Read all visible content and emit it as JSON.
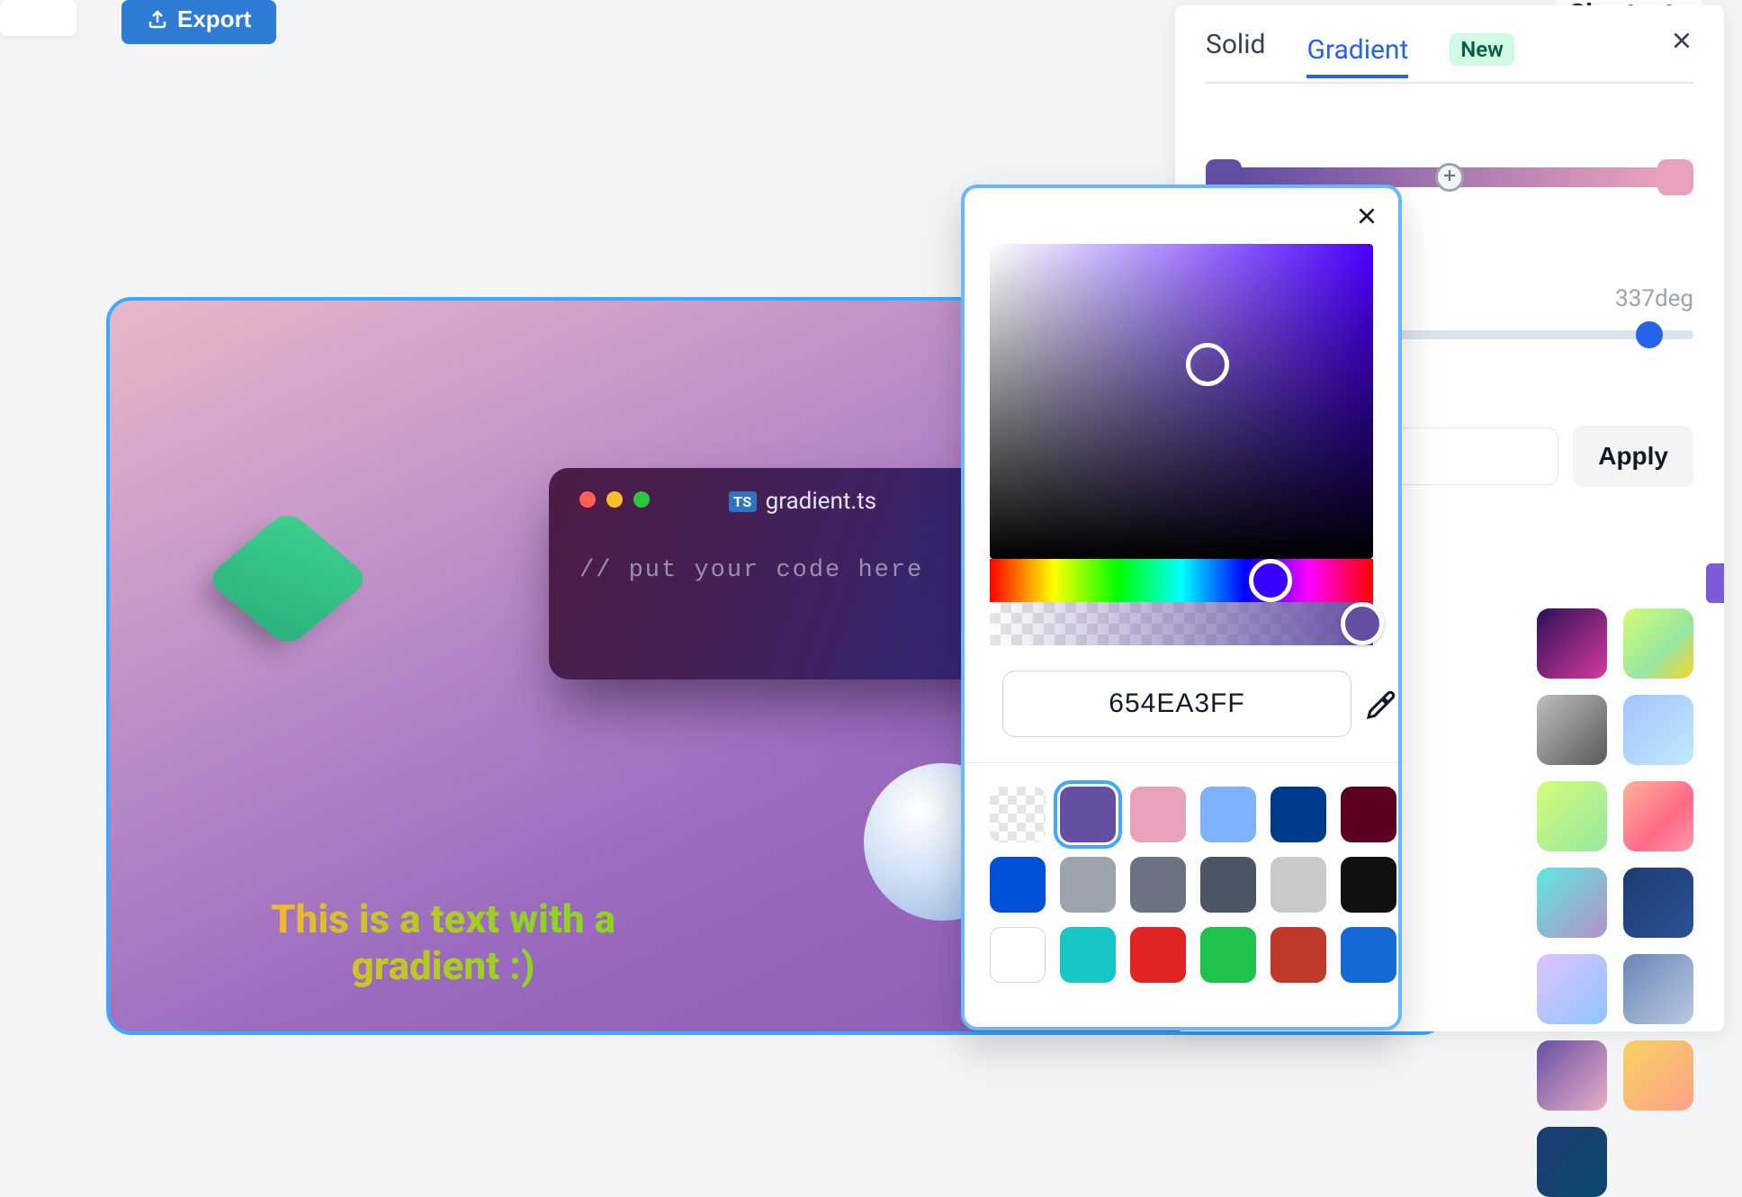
{
  "topbar": {
    "export_label": "Export",
    "shortcuts_label": "Shortcuts"
  },
  "canvas": {
    "file_name": "gradient.ts",
    "ts_badge": "TS",
    "code_comment": "// put your code here",
    "gradient_text": "This is a text with a gradient :)"
  },
  "side": {
    "tab_solid": "Solid",
    "tab_gradient": "Gradient",
    "badge_new": "New",
    "angle_text": "337deg",
    "apply_label": "Apply"
  },
  "picker": {
    "hex_value": "654EA3FF",
    "swatches": [
      "transparent",
      "#654ea3",
      "#e8a1bc",
      "#7fb1ff",
      "#003a8c",
      "#5c0021",
      "#0050d8",
      "#9ca3af",
      "#6b7280",
      "#4b5563",
      "#c9c9c9",
      "#111111",
      "#ffffff",
      "#18c6c6",
      "#e02424",
      "#1ec24b",
      "#c0392b",
      "#1469d4"
    ],
    "selected_index": 1
  },
  "colors": {
    "accent": "#2e7cd6",
    "picker_border": "#69b7ff",
    "current": "#654ea3"
  }
}
